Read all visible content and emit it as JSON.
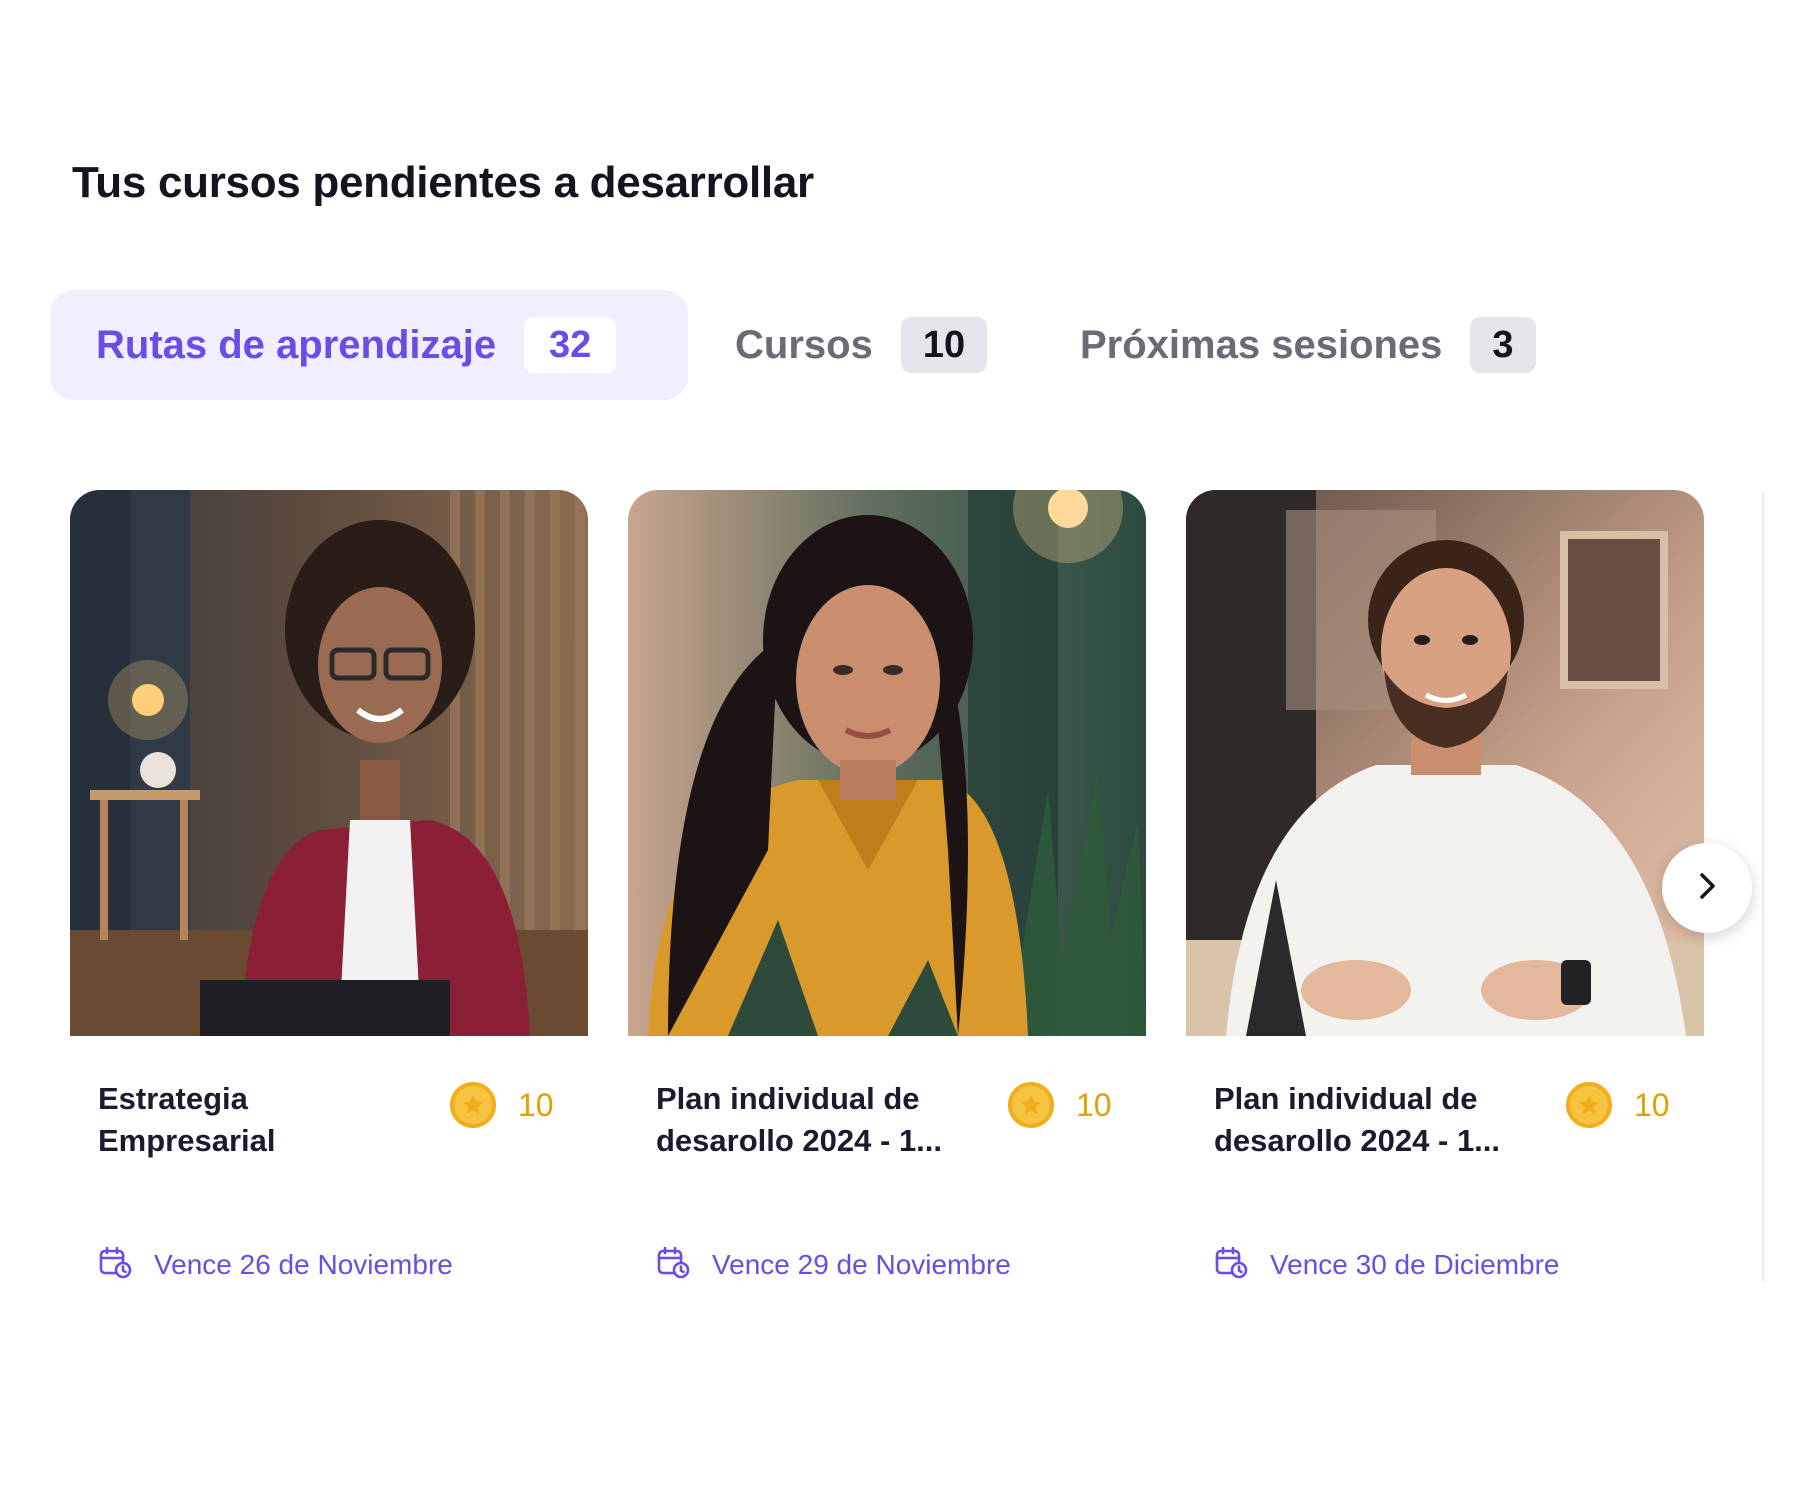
{
  "section": {
    "title": "Tus cursos pendientes a desarrollar"
  },
  "tabs": [
    {
      "label": "Rutas de aprendizaje",
      "count": "32",
      "active": true
    },
    {
      "label": "Cursos",
      "count": "10",
      "active": false
    },
    {
      "label": "Próximas sesiones",
      "count": "3",
      "active": false
    }
  ],
  "cards": [
    {
      "title": "Estrategia Empresarial",
      "points": "10",
      "due": "Vence 26 de Noviembre",
      "image": "photo-woman-curly-hair-red-jacket"
    },
    {
      "title": "Plan individual de desarollo 2024 - 1...",
      "points": "10",
      "due": "Vence 29 de Noviembre",
      "image": "photo-woman-long-hair-yellow-shirt"
    },
    {
      "title": "Plan individual de desarollo 2024 - 1...",
      "points": "10",
      "due": "Vence 30 de Diciembre",
      "image": "photo-man-beard-white-sweater"
    }
  ],
  "icons": {
    "points": "coin-star-icon",
    "due": "calendar-clock-icon",
    "next": "chevron-right-icon"
  },
  "colors": {
    "accent": "#6a4ce6",
    "accent_bg": "#f1eefe",
    "coin": "#f5c542",
    "points_text": "#e2a100"
  }
}
